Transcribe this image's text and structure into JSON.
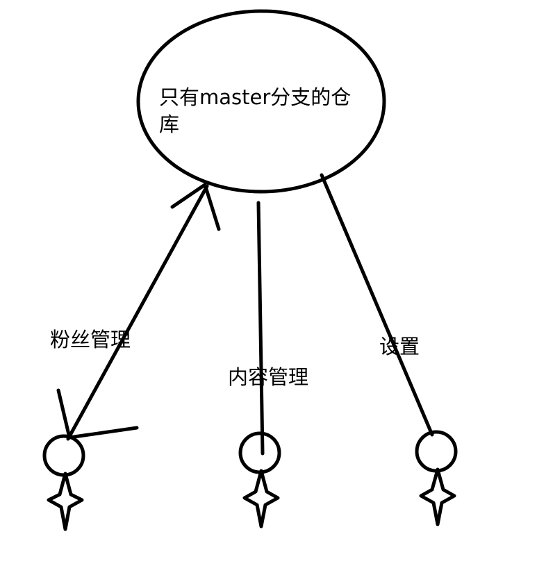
{
  "diagram": {
    "repository": {
      "label": "只有master分支的仓库"
    },
    "branches": [
      {
        "label": "粉丝管理"
      },
      {
        "label": "内容管理"
      },
      {
        "label": "设置"
      }
    ]
  },
  "colors": {
    "stroke": "#000000",
    "background": "#ffffff"
  }
}
